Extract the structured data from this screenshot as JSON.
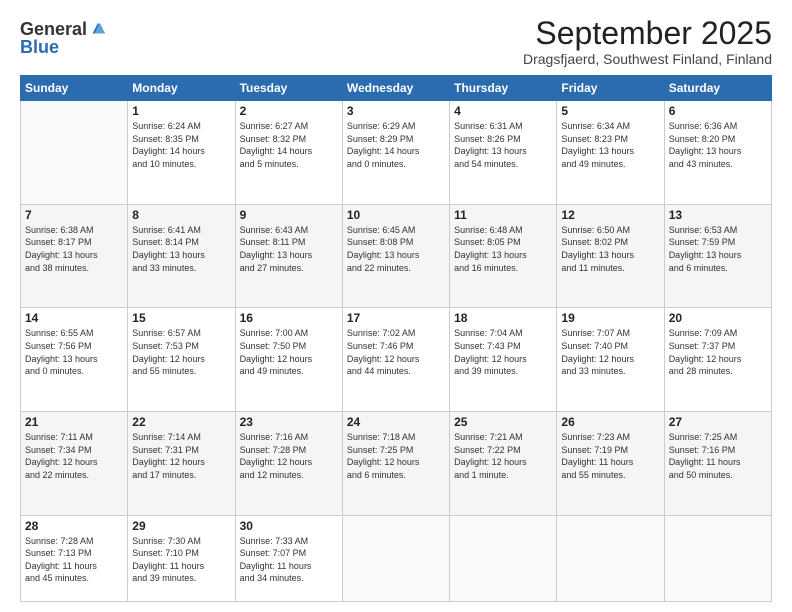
{
  "logo": {
    "general": "General",
    "blue": "Blue"
  },
  "title": "September 2025",
  "location": "Dragsfjaerd, Southwest Finland, Finland",
  "days_header": [
    "Sunday",
    "Monday",
    "Tuesday",
    "Wednesday",
    "Thursday",
    "Friday",
    "Saturday"
  ],
  "weeks": [
    [
      {
        "day": "",
        "info": ""
      },
      {
        "day": "1",
        "info": "Sunrise: 6:24 AM\nSunset: 8:35 PM\nDaylight: 14 hours\nand 10 minutes."
      },
      {
        "day": "2",
        "info": "Sunrise: 6:27 AM\nSunset: 8:32 PM\nDaylight: 14 hours\nand 5 minutes."
      },
      {
        "day": "3",
        "info": "Sunrise: 6:29 AM\nSunset: 8:29 PM\nDaylight: 14 hours\nand 0 minutes."
      },
      {
        "day": "4",
        "info": "Sunrise: 6:31 AM\nSunset: 8:26 PM\nDaylight: 13 hours\nand 54 minutes."
      },
      {
        "day": "5",
        "info": "Sunrise: 6:34 AM\nSunset: 8:23 PM\nDaylight: 13 hours\nand 49 minutes."
      },
      {
        "day": "6",
        "info": "Sunrise: 6:36 AM\nSunset: 8:20 PM\nDaylight: 13 hours\nand 43 minutes."
      }
    ],
    [
      {
        "day": "7",
        "info": "Sunrise: 6:38 AM\nSunset: 8:17 PM\nDaylight: 13 hours\nand 38 minutes."
      },
      {
        "day": "8",
        "info": "Sunrise: 6:41 AM\nSunset: 8:14 PM\nDaylight: 13 hours\nand 33 minutes."
      },
      {
        "day": "9",
        "info": "Sunrise: 6:43 AM\nSunset: 8:11 PM\nDaylight: 13 hours\nand 27 minutes."
      },
      {
        "day": "10",
        "info": "Sunrise: 6:45 AM\nSunset: 8:08 PM\nDaylight: 13 hours\nand 22 minutes."
      },
      {
        "day": "11",
        "info": "Sunrise: 6:48 AM\nSunset: 8:05 PM\nDaylight: 13 hours\nand 16 minutes."
      },
      {
        "day": "12",
        "info": "Sunrise: 6:50 AM\nSunset: 8:02 PM\nDaylight: 13 hours\nand 11 minutes."
      },
      {
        "day": "13",
        "info": "Sunrise: 6:53 AM\nSunset: 7:59 PM\nDaylight: 13 hours\nand 6 minutes."
      }
    ],
    [
      {
        "day": "14",
        "info": "Sunrise: 6:55 AM\nSunset: 7:56 PM\nDaylight: 13 hours\nand 0 minutes."
      },
      {
        "day": "15",
        "info": "Sunrise: 6:57 AM\nSunset: 7:53 PM\nDaylight: 12 hours\nand 55 minutes."
      },
      {
        "day": "16",
        "info": "Sunrise: 7:00 AM\nSunset: 7:50 PM\nDaylight: 12 hours\nand 49 minutes."
      },
      {
        "day": "17",
        "info": "Sunrise: 7:02 AM\nSunset: 7:46 PM\nDaylight: 12 hours\nand 44 minutes."
      },
      {
        "day": "18",
        "info": "Sunrise: 7:04 AM\nSunset: 7:43 PM\nDaylight: 12 hours\nand 39 minutes."
      },
      {
        "day": "19",
        "info": "Sunrise: 7:07 AM\nSunset: 7:40 PM\nDaylight: 12 hours\nand 33 minutes."
      },
      {
        "day": "20",
        "info": "Sunrise: 7:09 AM\nSunset: 7:37 PM\nDaylight: 12 hours\nand 28 minutes."
      }
    ],
    [
      {
        "day": "21",
        "info": "Sunrise: 7:11 AM\nSunset: 7:34 PM\nDaylight: 12 hours\nand 22 minutes."
      },
      {
        "day": "22",
        "info": "Sunrise: 7:14 AM\nSunset: 7:31 PM\nDaylight: 12 hours\nand 17 minutes."
      },
      {
        "day": "23",
        "info": "Sunrise: 7:16 AM\nSunset: 7:28 PM\nDaylight: 12 hours\nand 12 minutes."
      },
      {
        "day": "24",
        "info": "Sunrise: 7:18 AM\nSunset: 7:25 PM\nDaylight: 12 hours\nand 6 minutes."
      },
      {
        "day": "25",
        "info": "Sunrise: 7:21 AM\nSunset: 7:22 PM\nDaylight: 12 hours\nand 1 minute."
      },
      {
        "day": "26",
        "info": "Sunrise: 7:23 AM\nSunset: 7:19 PM\nDaylight: 11 hours\nand 55 minutes."
      },
      {
        "day": "27",
        "info": "Sunrise: 7:25 AM\nSunset: 7:16 PM\nDaylight: 11 hours\nand 50 minutes."
      }
    ],
    [
      {
        "day": "28",
        "info": "Sunrise: 7:28 AM\nSunset: 7:13 PM\nDaylight: 11 hours\nand 45 minutes."
      },
      {
        "day": "29",
        "info": "Sunrise: 7:30 AM\nSunset: 7:10 PM\nDaylight: 11 hours\nand 39 minutes."
      },
      {
        "day": "30",
        "info": "Sunrise: 7:33 AM\nSunset: 7:07 PM\nDaylight: 11 hours\nand 34 minutes."
      },
      {
        "day": "",
        "info": ""
      },
      {
        "day": "",
        "info": ""
      },
      {
        "day": "",
        "info": ""
      },
      {
        "day": "",
        "info": ""
      }
    ]
  ]
}
